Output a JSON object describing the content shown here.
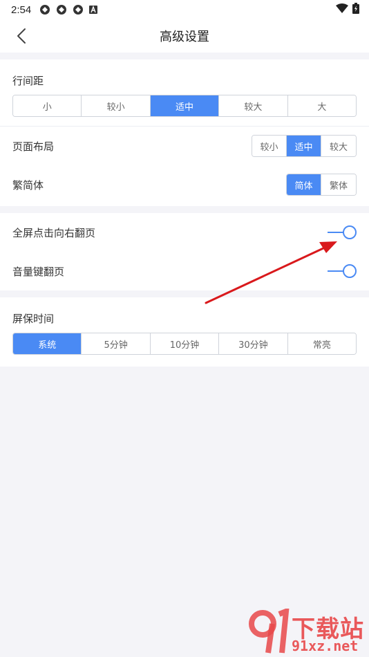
{
  "status": {
    "time": "2:54"
  },
  "header": {
    "title": "高级设置"
  },
  "line_spacing": {
    "label": "行间距",
    "options": [
      "小",
      "较小",
      "适中",
      "较大",
      "大"
    ],
    "selected": "适中"
  },
  "page_layout": {
    "label": "页面布局",
    "options": [
      "较小",
      "适中",
      "较大"
    ],
    "selected": "适中"
  },
  "script": {
    "label": "繁简体",
    "options": [
      "简体",
      "繁体"
    ],
    "selected": "简体"
  },
  "tap_right_flip": {
    "label": "全屏点击向右翻页",
    "enabled": true
  },
  "volume_flip": {
    "label": "音量键翻页",
    "enabled": true
  },
  "screensaver": {
    "label": "屏保时间",
    "options": [
      "系统",
      "5分钟",
      "10分钟",
      "30分钟",
      "常亮"
    ],
    "selected": "系统"
  },
  "watermark": {
    "top": "下载站",
    "bottom": "91xz.net"
  },
  "colors": {
    "accent": "#4a8af4",
    "arrow": "#d9191c",
    "watermark": "#e8484a"
  }
}
